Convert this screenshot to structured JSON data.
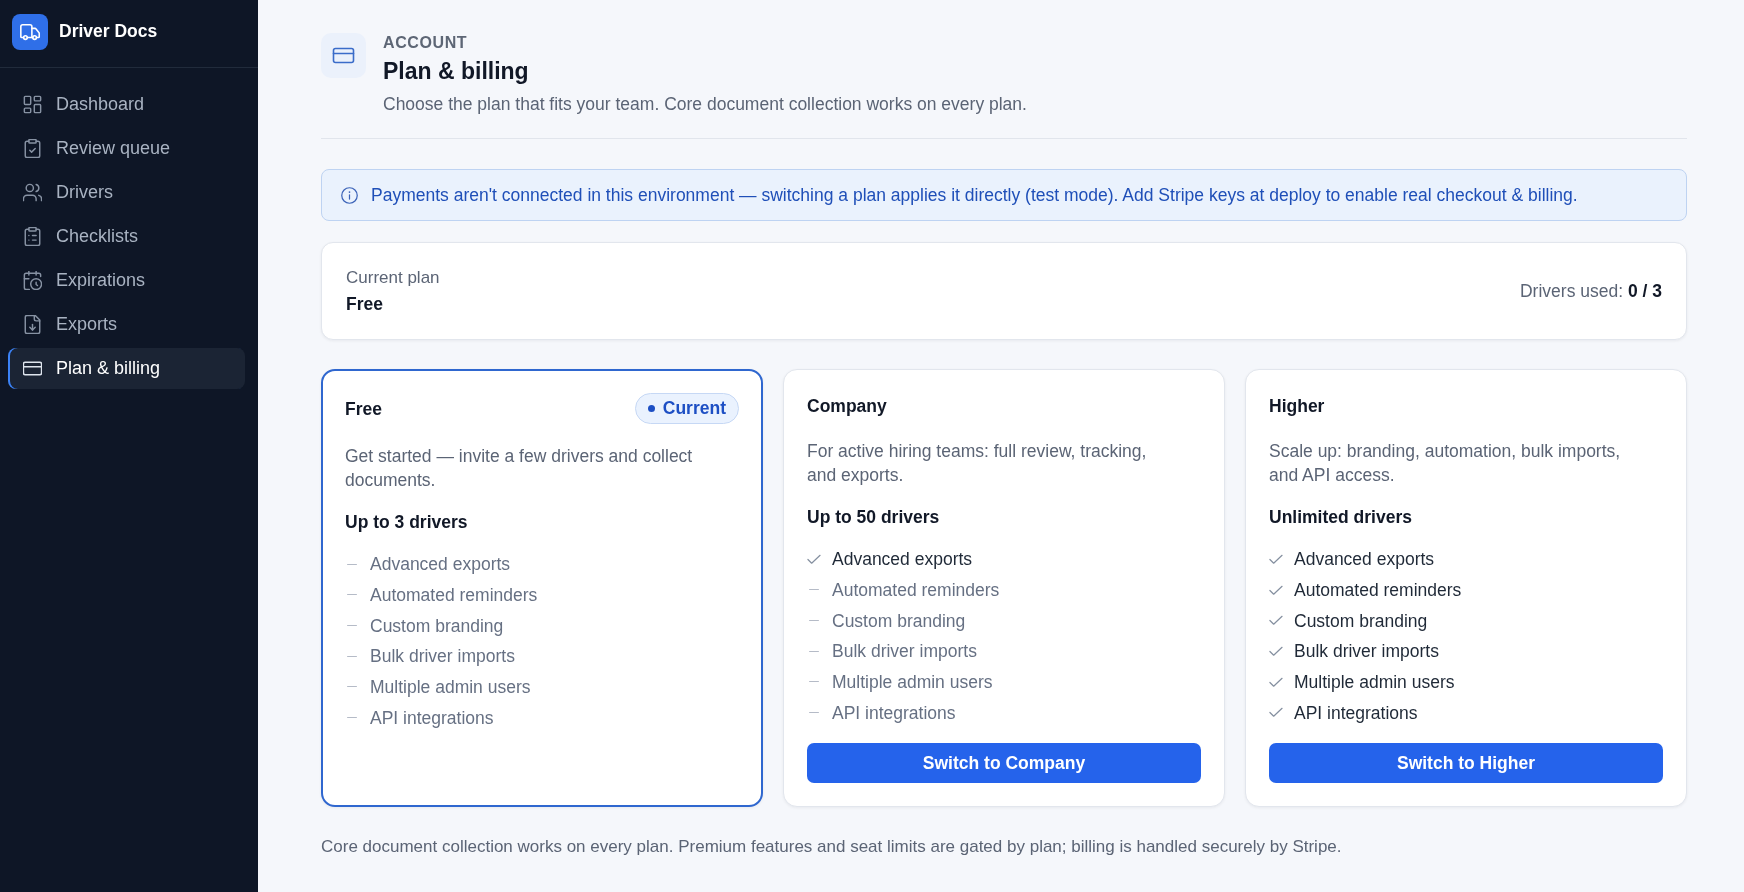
{
  "sidebar": {
    "brand": "Driver Docs",
    "items": [
      {
        "label": "Dashboard",
        "selected": false
      },
      {
        "label": "Review queue",
        "selected": false
      },
      {
        "label": "Drivers",
        "selected": false
      },
      {
        "label": "Checklists",
        "selected": false
      },
      {
        "label": "Expirations",
        "selected": false
      },
      {
        "label": "Exports",
        "selected": false
      },
      {
        "label": "Plan & billing",
        "selected": true
      }
    ]
  },
  "header": {
    "eyebrow": "ACCOUNT",
    "title": "Plan & billing",
    "subtitle": "Choose the plan that fits your team. Core document collection works on every plan."
  },
  "notice": {
    "text": "Payments aren't connected in this environment — switching a plan applies it directly (test mode). Add Stripe keys at deploy to enable real checkout & billing."
  },
  "current_plan": {
    "label": "Current plan",
    "value": "Free",
    "usage": "Drivers used: **0 / 3**"
  },
  "plans": [
    {
      "name": "Free",
      "current": true,
      "badge": "Current",
      "description": "Get started — invite a few drivers and collect documents.",
      "limit": "Up to 3 drivers",
      "features": [
        {
          "label": "Advanced exports",
          "included": false
        },
        {
          "label": "Automated reminders",
          "included": false
        },
        {
          "label": "Custom branding",
          "included": false
        },
        {
          "label": "Bulk driver imports",
          "included": false
        },
        {
          "label": "Multiple admin users",
          "included": false
        },
        {
          "label": "API integrations",
          "included": false
        }
      ]
    },
    {
      "name": "Company",
      "current": false,
      "description": "For active hiring teams: full review, tracking, and exports.",
      "limit": "Up to 50 drivers",
      "features": [
        {
          "label": "Advanced exports",
          "included": true
        },
        {
          "label": "Automated reminders",
          "included": false
        },
        {
          "label": "Custom branding",
          "included": false
        },
        {
          "label": "Bulk driver imports",
          "included": false
        },
        {
          "label": "Multiple admin users",
          "included": false
        },
        {
          "label": "API integrations",
          "included": false
        }
      ],
      "button": "Switch to Company"
    },
    {
      "name": "Higher",
      "current": false,
      "description": "Scale up: branding, automation, bulk imports, and API access.",
      "limit": "Unlimited drivers",
      "features": [
        {
          "label": "Advanced exports",
          "included": true
        },
        {
          "label": "Automated reminders",
          "included": true
        },
        {
          "label": "Custom branding",
          "included": true
        },
        {
          "label": "Bulk driver imports",
          "included": true
        },
        {
          "label": "Multiple admin users",
          "included": true
        },
        {
          "label": "API integrations",
          "included": true
        }
      ],
      "button": "Switch to Higher"
    }
  ],
  "footer_note": "Core document collection works on every plan. Premium features and seat limits are gated by plan; billing is handled securely by Stripe."
}
